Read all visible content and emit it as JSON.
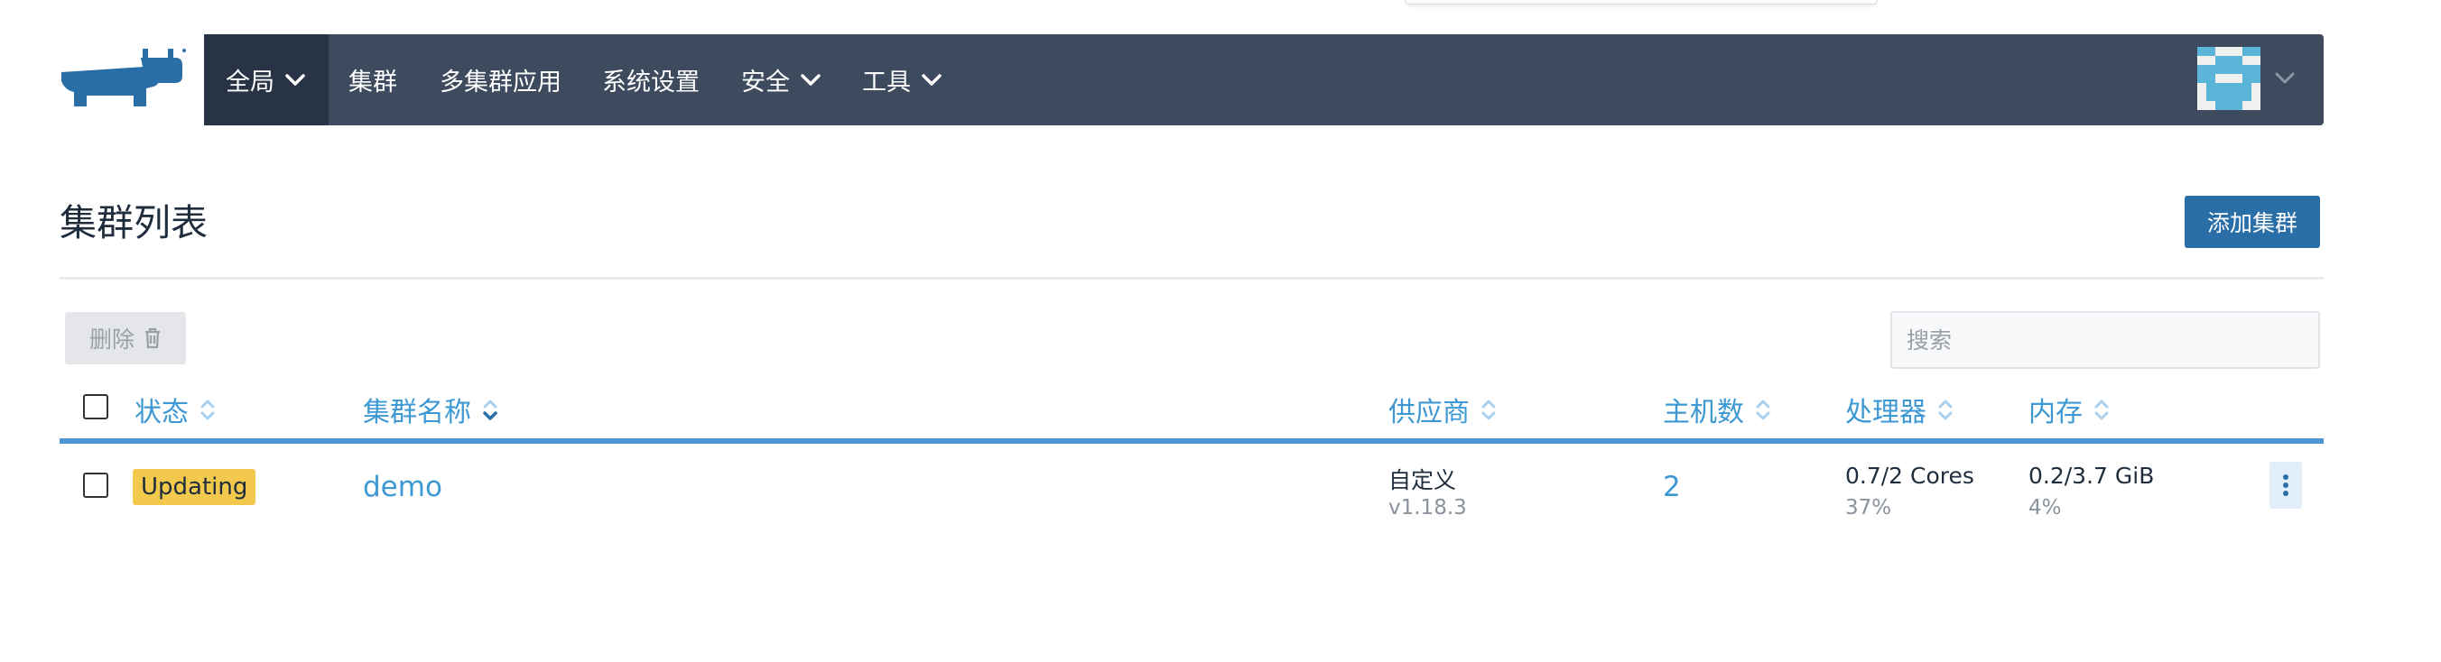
{
  "nav": {
    "items": [
      {
        "label": "全局",
        "has_dropdown": true,
        "active": true
      },
      {
        "label": "集群",
        "has_dropdown": false
      },
      {
        "label": "多集群应用",
        "has_dropdown": false
      },
      {
        "label": "系统设置",
        "has_dropdown": false
      },
      {
        "label": "安全",
        "has_dropdown": true
      },
      {
        "label": "工具",
        "has_dropdown": true
      }
    ],
    "logo_icon": "rancher-cow-logo",
    "user_menu_icon": "chevron-down-icon"
  },
  "page": {
    "title": "集群列表",
    "add_button_label": "添加集群",
    "delete_button_label": "删除",
    "search_placeholder": "搜索"
  },
  "table": {
    "columns": [
      {
        "key": "state",
        "label": "状态"
      },
      {
        "key": "name",
        "label": "集群名称",
        "sorted": "desc"
      },
      {
        "key": "provider",
        "label": "供应商"
      },
      {
        "key": "nodes",
        "label": "主机数"
      },
      {
        "key": "cpu",
        "label": "处理器"
      },
      {
        "key": "memory",
        "label": "内存"
      }
    ],
    "rows": [
      {
        "state": "Updating",
        "name": "demo",
        "provider": "自定义",
        "provider_version": "v1.18.3",
        "nodes": "2",
        "cpu": "0.7/2 Cores",
        "cpu_percent": "37%",
        "memory": "0.2/3.7 GiB",
        "memory_percent": "4%"
      }
    ]
  },
  "colors": {
    "nav_bg": "#3e4b5e",
    "nav_active_bg": "#283446",
    "primary": "#2a6ea8",
    "link": "#3d98d3",
    "updating_badge": "#f2c94c"
  }
}
